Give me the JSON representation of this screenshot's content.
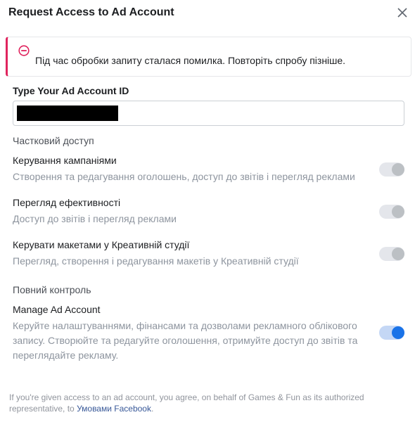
{
  "dialog": {
    "title": "Request Access to Ad Account",
    "close_icon": "close-icon"
  },
  "error": {
    "icon": "error-circle-icon",
    "message": "Під час обробки запиту сталася помилка. Повторіть спробу пізніше.",
    "accent_color": "#e0245e"
  },
  "account_field": {
    "label": "Type Your Ad Account ID",
    "value": ""
  },
  "partial_access": {
    "heading": "Частковий доступ",
    "items": [
      {
        "title": "Керування кампаніями",
        "description": "Створення та редагування оголошень, доступ до звітів і перегляд реклами",
        "enabled": false
      },
      {
        "title": "Перегляд ефективності",
        "description": "Доступ до звітів і перегляд реклами",
        "enabled": false
      },
      {
        "title": "Керувати макетами у Креативній студії",
        "description": "Перегляд, створення і редагування макетів у Креативній студії",
        "enabled": false
      }
    ]
  },
  "full_control": {
    "heading": "Повний контроль",
    "item": {
      "title": "Manage Ad Account",
      "description": "Керуйте налаштуваннями, фінансами та дозволами рекламного облікового запису. Створюйте та редагуйте оголошення, отримуйте доступ до звітів та переглядайте рекламу.",
      "enabled": true
    }
  },
  "footer": {
    "text_before": "If you're given access to an ad account, you agree, on behalf of Games & Fun as its authorized representative, to ",
    "link": "Умовами Facebook",
    "text_after": "."
  },
  "colors": {
    "toggle_on": "#1a73e8",
    "toggle_off": "#bcc0c4"
  }
}
